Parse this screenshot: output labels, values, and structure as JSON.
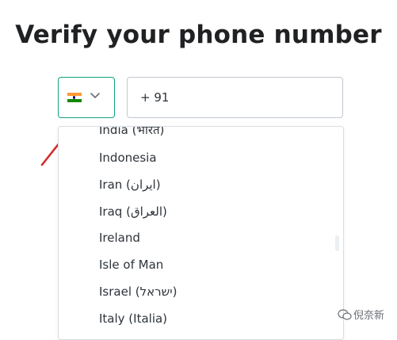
{
  "page": {
    "title": "Verify your phone number"
  },
  "country_selector": {
    "selected_flag": "india-flag",
    "chevron": "chevron-down-icon",
    "accent": "#10a37f"
  },
  "phone": {
    "value": "+ 91"
  },
  "dropdown": {
    "options": [
      "India (भारत)",
      "Indonesia",
      "Iran (ایران)",
      "Iraq (العراق)",
      "Ireland",
      "Isle of Man",
      "Israel (ישראל)",
      "Italy (Italia)"
    ]
  },
  "annotation": {
    "arrow_color": "#d42a2a"
  },
  "watermark": {
    "text": "倪奈新"
  }
}
